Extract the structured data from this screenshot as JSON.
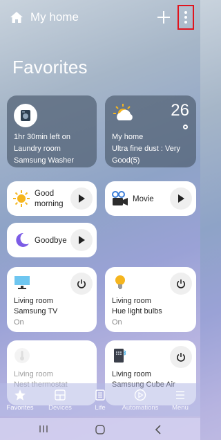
{
  "header": {
    "title": "My home",
    "home_icon": "home-icon",
    "add_icon": "plus-icon",
    "more_icon": "more-vertical-icon"
  },
  "page": {
    "heading": "Favorites"
  },
  "cards": {
    "washer": {
      "line1": "1hr 30min left on",
      "line2": "Laundry room",
      "line3": "Samsung Washer",
      "icon": "washer-icon"
    },
    "weather": {
      "temp": "26",
      "line1": "My home",
      "line2": "Ultra fine dust : Very",
      "line3": "Good(5)",
      "icon": "partly-sunny-icon"
    }
  },
  "scenes": [
    {
      "label_line1": "Good",
      "label_line2": "morning",
      "icon": "sun-icon"
    },
    {
      "label": "Movie",
      "icon": "video-camera-icon"
    },
    {
      "label": "Goodbye",
      "icon": "moon-icon"
    }
  ],
  "devices": [
    {
      "room": "Living room",
      "name": "Samsung TV",
      "state": "On",
      "icon": "tv-icon"
    },
    {
      "room": "Living room",
      "name": "Hue light bulbs",
      "state": "On",
      "icon": "bulb-icon"
    },
    {
      "room": "Living room",
      "name": "Nest thermostat",
      "state": "",
      "icon": "thermometer-icon"
    },
    {
      "room": "Living room",
      "name": "Samsung Cube Air",
      "state": "",
      "icon": "air-purifier-icon"
    }
  ],
  "nav": {
    "favorites": "Favorites",
    "devices": "Devices",
    "life": "Life",
    "automations": "Automations",
    "menu": "Menu"
  },
  "colors": {
    "highlight": "#e0141e",
    "accent_sun": "#f5b51e",
    "moon": "#7c5ce6",
    "tv": "#4ab0e6"
  }
}
